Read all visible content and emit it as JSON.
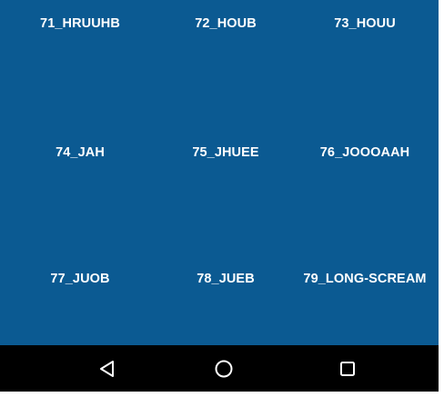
{
  "grid": {
    "items": [
      {
        "label": "71_HRUUHB"
      },
      {
        "label": "72_HOUB"
      },
      {
        "label": "73_HOUU"
      },
      {
        "label": "74_JAH"
      },
      {
        "label": "75_JHUEE"
      },
      {
        "label": "76_JOOOAAH"
      },
      {
        "label": "77_JUOB"
      },
      {
        "label": "78_JUEB"
      },
      {
        "label": "79_LONG-SCREAM"
      }
    ]
  },
  "colors": {
    "background": "#0b5a92",
    "text": "#ffffff",
    "navbar": "#000000"
  },
  "navbar": {
    "buttons": [
      {
        "icon": "back-triangle-icon"
      },
      {
        "icon": "home-circle-icon"
      },
      {
        "icon": "recents-square-icon"
      }
    ]
  }
}
